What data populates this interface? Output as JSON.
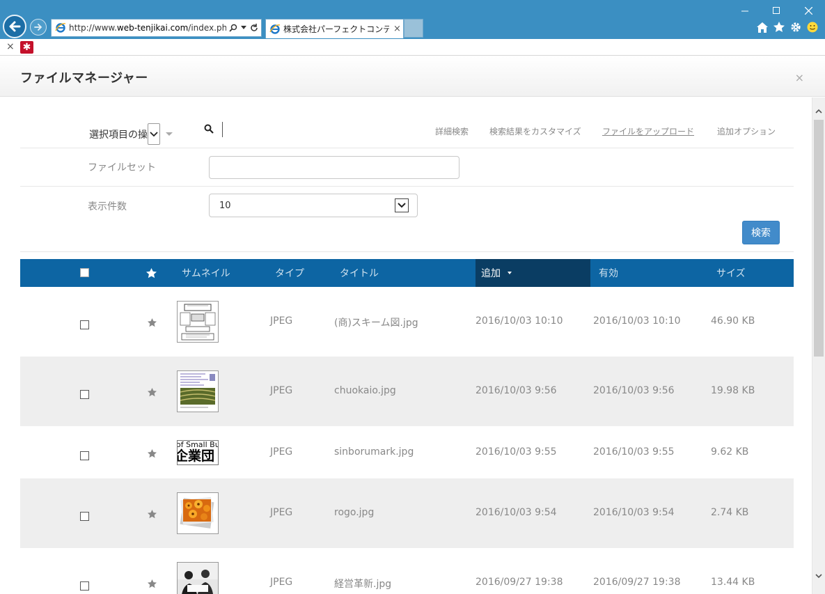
{
  "browser": {
    "url_prefix": "http://www.",
    "url_domain": "web-tenjikai.com",
    "url_suffix": "/index.php?c",
    "tab_title": "株式会社パーフェクトコンディシ...",
    "tab_close": "×",
    "notification_close": "×",
    "accent_color": "#3b8fc2"
  },
  "modal": {
    "title": "ファイルマネージャー",
    "close": "×"
  },
  "toolbar": {
    "bulk_action_label": "選択項目の操",
    "links": {
      "advanced_search": "詳細検索",
      "customize_results": "検索結果をカスタマイズ",
      "upload_file": "ファイルをアップロード",
      "more_options": "追加オプション"
    }
  },
  "filters": {
    "fileset_label": "ファイルセット",
    "fileset_value": "",
    "per_page_label": "表示件数",
    "per_page_value": "10",
    "search_button": "検索"
  },
  "table": {
    "headers": {
      "thumbnail": "サムネイル",
      "type": "タイプ",
      "title": "タイトル",
      "added": "追加",
      "active": "有効",
      "size": "サイズ"
    },
    "sorted_column": "added",
    "rows": [
      {
        "type": "JPEG",
        "title": "(商)スキーム図.jpg",
        "added": "2016/10/03 10:10",
        "active": "2016/10/03 10:10",
        "size": "46.90 KB",
        "thumb_icon": "scheme-diagram-thumbnail",
        "thumb_text": ""
      },
      {
        "type": "JPEG",
        "title": "chuokaio.jpg",
        "added": "2016/10/03 9:56",
        "active": "2016/10/03 9:56",
        "size": "19.98 KB",
        "thumb_icon": "document-photo-thumbnail",
        "thumb_text": ""
      },
      {
        "type": "JPEG",
        "title": "sinborumark.jpg",
        "added": "2016/10/03 9:55",
        "active": "2016/10/03 9:55",
        "size": "9.62 KB",
        "thumb_icon": "symbol-mark-thumbnail",
        "thumb_text": {
          "line1": "of Small Bu",
          "line2": "企業団"
        }
      },
      {
        "type": "JPEG",
        "title": "rogo.jpg",
        "added": "2016/10/03 9:54",
        "active": "2016/10/03 9:54",
        "size": "2.74 KB",
        "thumb_icon": "flower-photo-thumbnail",
        "thumb_text": ""
      },
      {
        "type": "JPEG",
        "title": "経営革新.jpg",
        "added": "2016/09/27 19:38",
        "active": "2016/09/27 19:38",
        "size": "13.44 KB",
        "thumb_icon": "people-photo-thumbnail",
        "thumb_text": ""
      }
    ]
  },
  "colors": {
    "table_header": "#0d65a3",
    "sorted_header": "#0a3d63",
    "button": "#428bca"
  }
}
